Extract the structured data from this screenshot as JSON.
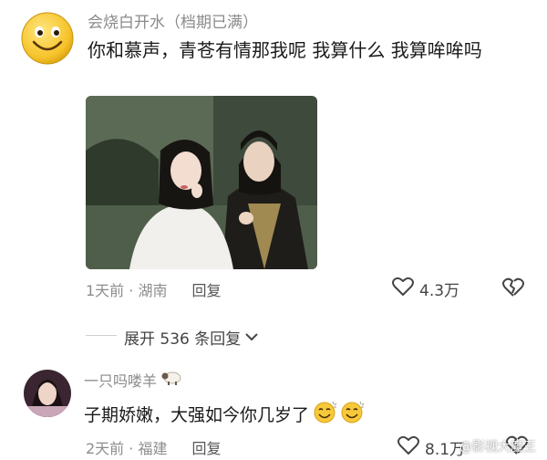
{
  "comment1": {
    "username": "会烧白开水（档期已满）",
    "text": "你和慕声，青苍有情那我呢 我算什么 我算哞哞吗",
    "time_location": "1天前 · 湖南",
    "reply_label": "回复",
    "like_count": "4.3万"
  },
  "expand_replies": {
    "label": "展开 536 条回复"
  },
  "comment2": {
    "username": "一只吗喽羊",
    "text": "子期娇嫩，大强如今你几岁了",
    "time_location": "2天前 · 福建",
    "reply_label": "回复",
    "like_count": "8.1万"
  },
  "watermark": {
    "text": "@影视大魔王"
  }
}
